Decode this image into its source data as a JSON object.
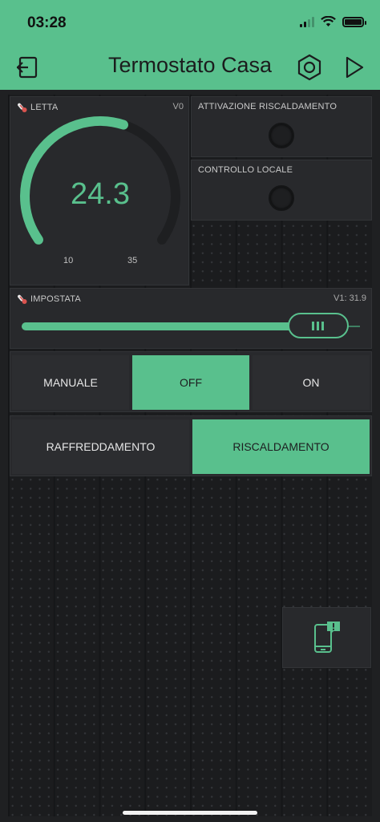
{
  "status_bar": {
    "time": "03:28"
  },
  "header": {
    "title": "Termostato Casa"
  },
  "widgets": {
    "letta": {
      "label": "LETTA",
      "pin": "V0",
      "value": "24.3",
      "min": "10",
      "max": "35",
      "min_value": 10,
      "max_value": 35,
      "current": 24.3
    },
    "attivazione": {
      "label": "ATTIVAZIONE RISCALDAMENTO"
    },
    "controllo": {
      "label": "CONTROLLO LOCALE"
    },
    "impostata": {
      "label": "IMPOSTATA",
      "pin": "V1: 31.9",
      "value": 31.9,
      "min_value": 10,
      "max_value": 35
    },
    "mode": {
      "pin": "V3",
      "options": [
        "MANUALE",
        "OFF",
        "ON"
      ],
      "selected": 1
    },
    "function": {
      "options": [
        "RAFFREDDAMENTO",
        "RISCALDAMENTO"
      ],
      "selected": 1
    }
  },
  "colors": {
    "accent": "#59c08d",
    "panel": "#28292c",
    "background": "#1b1c1e"
  },
  "icons": {
    "back": "exit-icon",
    "settings": "hexagon-nut-icon",
    "play": "play-icon",
    "notify": "phone-notification-icon",
    "thermometer": "thermometer-icon"
  }
}
